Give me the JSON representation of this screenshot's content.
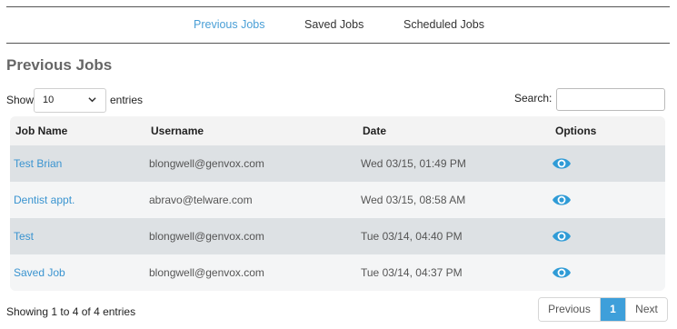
{
  "nav": {
    "tabs": [
      {
        "label": "Previous Jobs",
        "active": true
      },
      {
        "label": "Saved Jobs",
        "active": false
      },
      {
        "label": "Scheduled Jobs",
        "active": false
      }
    ]
  },
  "page": {
    "title": "Previous Jobs"
  },
  "controls": {
    "show_label": "Show",
    "length_value": "10",
    "entries_label": "entries",
    "search_label": "Search:",
    "search_value": ""
  },
  "table": {
    "headers": {
      "name": "Job Name",
      "user": "Username",
      "date": "Date",
      "options": "Options"
    },
    "rows": [
      {
        "name": "Test Brian",
        "user": "blongwell@genvox.com",
        "date": "Wed 03/15, 01:49 PM",
        "option_icon": "eye-icon"
      },
      {
        "name": "Dentist appt.",
        "user": "abravo@telware.com",
        "date": "Wed 03/15, 08:58 AM",
        "option_icon": "eye-icon"
      },
      {
        "name": "Test",
        "user": "blongwell@genvox.com",
        "date": "Tue 03/14, 04:40 PM",
        "option_icon": "eye-icon"
      },
      {
        "name": "Saved Job",
        "user": "blongwell@genvox.com",
        "date": "Tue 03/14, 04:37 PM",
        "option_icon": "eye-icon"
      }
    ]
  },
  "footer": {
    "info": "Showing 1 to 4 of 4 entries",
    "pagination": {
      "previous": "Previous",
      "current": "1",
      "next": "Next"
    }
  },
  "colors": {
    "accent": "#3e9fda",
    "link": "#3a94d0",
    "row_odd": "#dde1e4",
    "row_even": "#f4f5f6"
  }
}
